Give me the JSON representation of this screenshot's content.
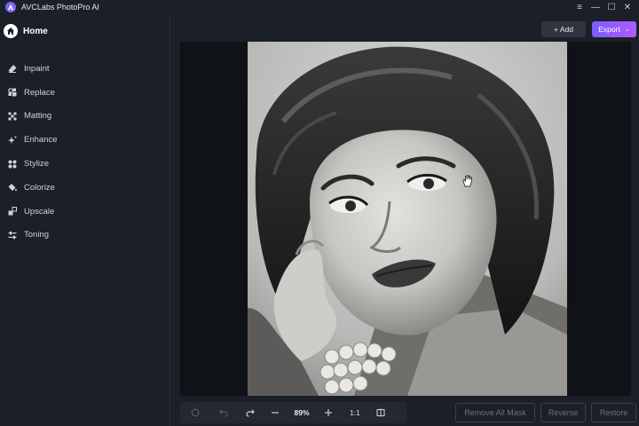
{
  "app": {
    "title": "AVCLabs PhotoPro AI"
  },
  "window_controls": [
    "≡",
    "—",
    "☐",
    "✕"
  ],
  "sidebar": {
    "home_label": "Home",
    "items": [
      {
        "label": "Inpaint",
        "icon": "eraser-icon"
      },
      {
        "label": "Replace",
        "icon": "replace-icon"
      },
      {
        "label": "Matting",
        "icon": "matting-icon"
      },
      {
        "label": "Enhance",
        "icon": "sparkle-icon"
      },
      {
        "label": "Stylize",
        "icon": "stylize-icon"
      },
      {
        "label": "Colorize",
        "icon": "paint-bucket-icon"
      },
      {
        "label": "Upscale",
        "icon": "upscale-icon"
      },
      {
        "label": "Toning",
        "icon": "sliders-icon"
      }
    ]
  },
  "toolbar": {
    "add_label": "+ Add",
    "export_label": "Export"
  },
  "bottom": {
    "zoom": "89%",
    "ratio": "1:1",
    "remove_mask_label": "Remove All Mask",
    "reverse_label": "Reverse",
    "restore_label": "Restore"
  },
  "colors": {
    "accent_start": "#7a5cff",
    "accent_end": "#b05cff",
    "background": "#1b1f27"
  }
}
